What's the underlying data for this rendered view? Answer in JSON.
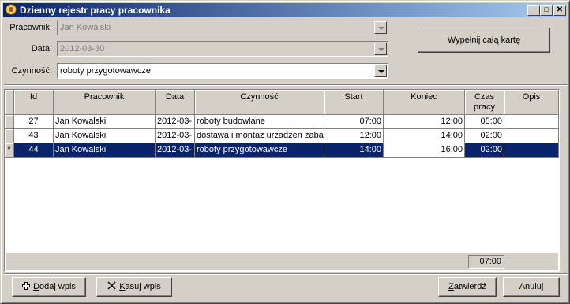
{
  "window": {
    "title": "Dzienny rejestr pracy pracownika",
    "minimize": "_",
    "maximize": "□",
    "close": "✕"
  },
  "form": {
    "employee_label": "Pracownik:",
    "employee_value": "Jan Kowalski",
    "date_label": "Data:",
    "date_value": "2012-03-30",
    "activity_label": "Czynność:",
    "activity_value": "roboty przygotowawcze",
    "fill_card_button": "Wypełnij całą kartę"
  },
  "grid": {
    "columns": [
      "Id",
      "Pracownik",
      "Data",
      "Czynność",
      "Start",
      "Koniec",
      "Czas pracy",
      "Opis"
    ],
    "rows": [
      {
        "indicator": "",
        "id": "27",
        "employee": "Jan Kowalski",
        "date": "2012-03-",
        "activity": "roboty budowlane",
        "start": "07:00",
        "end": "12:00",
        "duration": "05:00",
        "description": ""
      },
      {
        "indicator": "",
        "id": "43",
        "employee": "Jan Kowalski",
        "date": "2012-03-",
        "activity": "dostawa i montaz urzadzen zabav",
        "start": "12:00",
        "end": "14:00",
        "duration": "02:00",
        "description": ""
      },
      {
        "indicator": "*",
        "id": "44",
        "employee": "Jan Kowalski",
        "date": "2012-03-",
        "activity": "roboty przygotowawcze",
        "start": "14:00",
        "end": "16:00",
        "duration": "02:00",
        "description": ""
      }
    ],
    "total_duration": "07:00"
  },
  "buttons": {
    "add_prefix": "D",
    "add_rest": "odaj wpis",
    "delete_prefix": "K",
    "delete_rest": "asuj wpis",
    "confirm_prefix": "Z",
    "confirm_rest": "atwierdź",
    "cancel": "Anuluj"
  },
  "colors": {
    "titlebar": "#0a246a",
    "selection": "#0a246a",
    "face": "#d4d0c8"
  }
}
